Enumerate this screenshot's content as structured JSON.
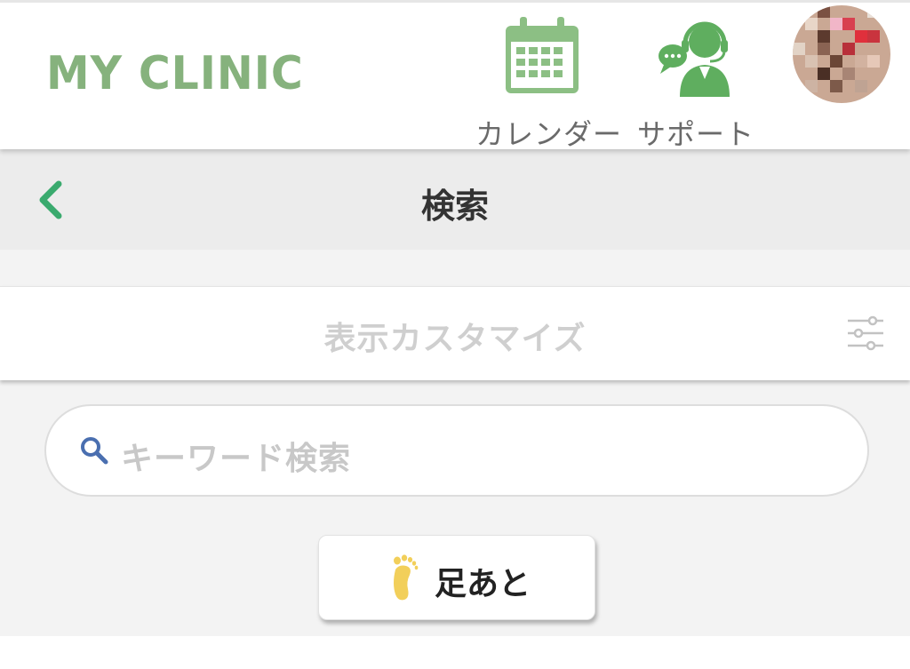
{
  "header": {
    "logo": "MY CLINIC",
    "calendar_label": "カレンダー",
    "support_label": "サポート"
  },
  "titlebar": {
    "title": "検索"
  },
  "customize": {
    "label": "表示カスタマイズ"
  },
  "search": {
    "placeholder": "キーワード検索"
  },
  "footprint": {
    "label": "足あと"
  },
  "colors": {
    "brand_green": "#86b27d",
    "back_arrow": "#3aaa6e",
    "icon_green": "#5fae5f",
    "search_icon": "#4a6fb0",
    "foot_icon": "#f2cf5a"
  }
}
